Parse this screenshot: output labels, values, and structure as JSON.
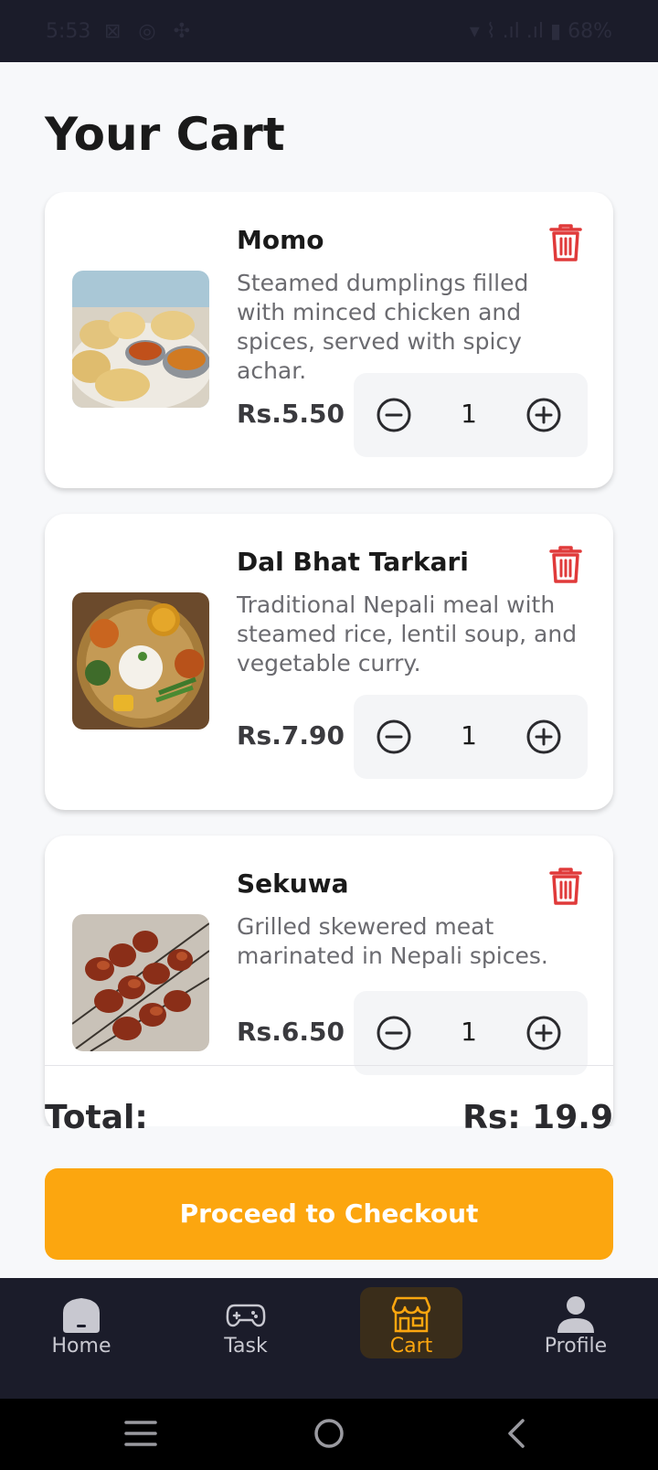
{
  "status_bar": {
    "time": "5:53",
    "left_icons": "⊠ ◎ ✣",
    "right_text": "▾ ⌇ .ıl .ıl ▮ 68%"
  },
  "page": {
    "title": "Your Cart"
  },
  "cart": {
    "items": [
      {
        "name": "Momo",
        "description": "Steamed dumplings filled with minced chicken and spices, served with spicy achar.",
        "price": "Rs.5.50",
        "quantity": "1",
        "image_icon": "momo-photo"
      },
      {
        "name": "Dal Bhat Tarkari",
        "description": "Traditional Nepali meal with steamed rice, lentil soup, and vegetable curry.",
        "price": "Rs.7.90",
        "quantity": "1",
        "image_icon": "dal-bhat-photo"
      },
      {
        "name": "Sekuwa",
        "description": "Grilled skewered meat marinated in Nepali spices.",
        "price": "Rs.6.50",
        "quantity": "1",
        "image_icon": "sekuwa-photo"
      }
    ]
  },
  "summary": {
    "total_label": "Total:",
    "total_value": "Rs: 19.9"
  },
  "checkout": {
    "label": "Proceed to Checkout"
  },
  "bottom_nav": {
    "items": [
      {
        "label": "Home",
        "icon": "home-icon"
      },
      {
        "label": "Task",
        "icon": "gamepad-icon"
      },
      {
        "label": "Cart",
        "icon": "store-icon",
        "active": true
      },
      {
        "label": "Profile",
        "icon": "person-icon"
      }
    ]
  },
  "colors": {
    "accent": "#fca60f",
    "delete": "#e03a3a",
    "nav_bg": "#1b1c2a",
    "page_bg": "#f7f8fa"
  }
}
